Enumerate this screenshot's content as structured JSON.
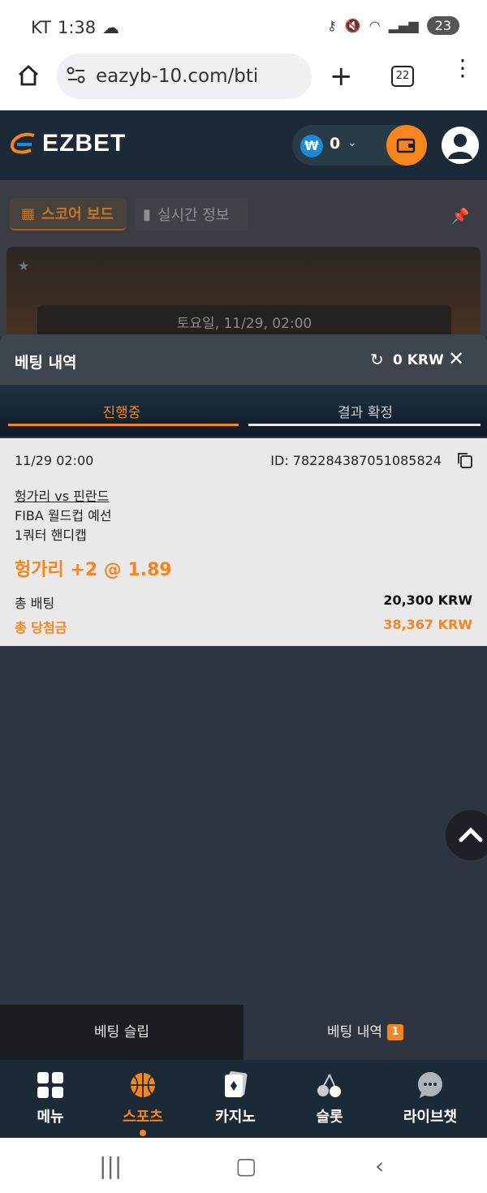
{
  "status": {
    "carrier": "KT",
    "time": "1:38",
    "battery": "23"
  },
  "browser": {
    "url": "eazyb-10.com/bti",
    "tab_count": "22"
  },
  "header": {
    "brand": "EZBET",
    "currency_symbol": "₩",
    "balance": "0"
  },
  "background": {
    "score_tab": "스코어 보드",
    "live_tab": "실시간 정보",
    "match_date": "토요일, 11/29, 02:00"
  },
  "sheet": {
    "title": "베팅 내역",
    "balance": "0 KRW",
    "tabs": [
      "진행중",
      "결과 확정"
    ]
  },
  "bet": {
    "datetime": "11/29 02:00",
    "id": "ID: 782284387051085824",
    "match": "헝가리 vs 핀란드",
    "league": "FIBA 월드컵 예선",
    "market": "1쿼터 핸디캡",
    "pick": "헝가리 +2 @ 1.89",
    "stake_label": "총 배팅",
    "stake_value": "20,300 KRW",
    "win_label": "총 당첨금",
    "win_value": "38,367 KRW"
  },
  "slip": {
    "slip_label": "베팅 슬립",
    "history_label": "베팅 내역",
    "history_count": "1"
  },
  "nav": [
    "메뉴",
    "스포츠",
    "카지노",
    "슬롯",
    "라이브챗"
  ],
  "colors": {
    "accent": "#f5861f",
    "header_bg": "#1b2a36",
    "sheet_bg": "#2f3540",
    "card_bg": "#e9e9e9"
  }
}
